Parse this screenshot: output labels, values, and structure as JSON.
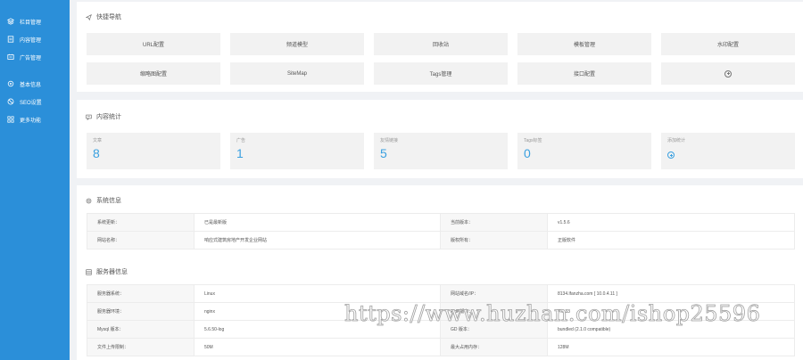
{
  "colors": {
    "sidebar_bg": "#2b8fd9",
    "stat_value": "#3aa0e0",
    "panel_bg": "#ffffff",
    "page_bg": "#f0f2f5",
    "button_bg": "#f2f2f2"
  },
  "sidebar": {
    "items": [
      {
        "label": "栏目管理",
        "icon": "layers-icon"
      },
      {
        "label": "内容管理",
        "icon": "document-icon"
      },
      {
        "label": "广告管理",
        "icon": "ad-icon"
      },
      {
        "label": "基本信息",
        "icon": "gear-icon"
      },
      {
        "label": "SEO设置",
        "icon": "block-icon"
      },
      {
        "label": "更多功能",
        "icon": "grid-icon"
      }
    ]
  },
  "quick_nav": {
    "title": "快捷导航",
    "icon": "send-icon",
    "items": [
      "URL配置",
      "频道模型",
      "回收站",
      "模板管理",
      "水印配置",
      "缩略图配置",
      "SiteMap",
      "Tags管理",
      "接口配置"
    ],
    "add_icon": "plus-circle-icon"
  },
  "content_stats": {
    "title": "内容统计",
    "icon": "chat-icon",
    "cards": [
      {
        "label": "文章",
        "value": "8"
      },
      {
        "label": "广告",
        "value": "1"
      },
      {
        "label": "友情链接",
        "value": "5"
      },
      {
        "label": "Tags标签",
        "value": "0"
      }
    ],
    "add_label": "添加统计",
    "add_icon": "plus-circle-icon"
  },
  "system_info": {
    "title": "系统信息",
    "icon": "gear-icon",
    "rows": [
      [
        "系统更新：",
        "已是最新版",
        "当前版本：",
        "v1.5.6"
      ],
      [
        "网站名称：",
        "响应式建筑房地产开发企业网站",
        "版权所有：",
        "正版软件"
      ]
    ]
  },
  "server_info": {
    "title": "服务器信息",
    "icon": "server-icon",
    "rows": [
      [
        "服务器系统：",
        "Linux",
        "网站域名/IP：",
        "8134.lfanzha.com [ 10.0.4.11 ]"
      ],
      [
        "服务器环境：",
        "nginx",
        "PHP版本：",
        "7.0.33"
      ],
      [
        "Mysql 版本：",
        "5.6.50-log",
        "GD 版本：",
        "bundled (2.1.0 compatible)"
      ],
      [
        "文件上传限制：",
        "50M",
        "最大占用内存：",
        "128M"
      ]
    ]
  },
  "watermark": "https://www.huzhan.com/ishop25596"
}
